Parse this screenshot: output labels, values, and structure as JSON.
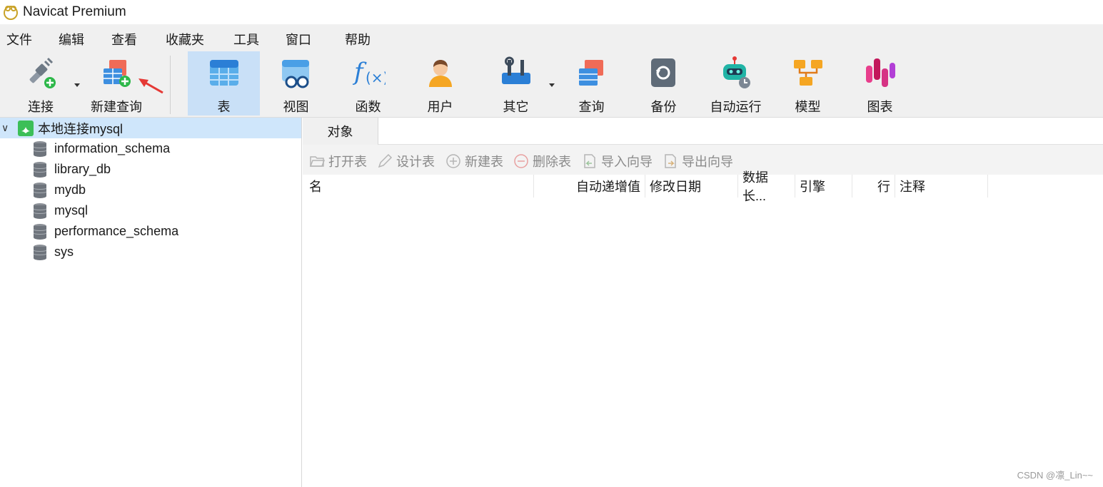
{
  "window": {
    "title": "Navicat Premium"
  },
  "menu": [
    "文件",
    "编辑",
    "查看",
    "收藏夹",
    "工具",
    "窗口",
    "帮助"
  ],
  "toolbar": {
    "connect": "连接",
    "new_query": "新建查询",
    "table": "表",
    "view": "视图",
    "function": "函数",
    "user": "用户",
    "other": "其它",
    "query": "查询",
    "backup": "备份",
    "automation": "自动运行",
    "model": "模型",
    "chart": "图表"
  },
  "sidebar": {
    "connection": "本地连接mysql",
    "databases": [
      "information_schema",
      "library_db",
      "mydb",
      "mysql",
      "performance_schema",
      "sys"
    ]
  },
  "main": {
    "tab": "对象",
    "actions": {
      "open": "打开表",
      "design": "设计表",
      "new": "新建表",
      "delete": "删除表",
      "import": "导入向导",
      "export": "导出向导"
    },
    "columns": {
      "name": "名",
      "auto_increment": "自动递增值",
      "modified": "修改日期",
      "data_length": "数据长...",
      "engine": "引擎",
      "rows": "行",
      "comment": "注释"
    }
  },
  "watermark": "CSDN @凛_Lin~~",
  "colors": {
    "selection": "#cfe6fb",
    "active_tool": "#c9e0f7",
    "accent_red": "#e53935"
  }
}
